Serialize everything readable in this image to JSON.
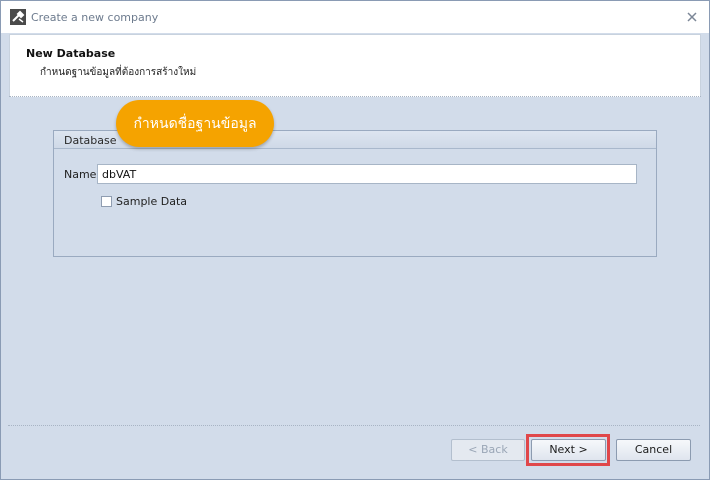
{
  "window": {
    "title": "Create a new company"
  },
  "header": {
    "title": "New Database",
    "subtitle": "กำหนดฐานข้อมูลที่ต้องการสร้างใหม่"
  },
  "group": {
    "label": "Database"
  },
  "form": {
    "name_label": "Name",
    "name_value": "dbVAT",
    "sample_data_label": "Sample Data",
    "sample_data_checked": false
  },
  "callout": {
    "text": "กำหนดชื่อฐานข้อมูล",
    "color": "#f5a300"
  },
  "buttons": {
    "back_label": "< Back",
    "next_label": "Next >",
    "cancel_label": "Cancel"
  },
  "icons": {
    "app": "wrench-icon",
    "close": "close-icon",
    "checkbox": "checkbox-icon"
  },
  "colors": {
    "background": "#d2dcea",
    "highlight": "#e0474a"
  }
}
